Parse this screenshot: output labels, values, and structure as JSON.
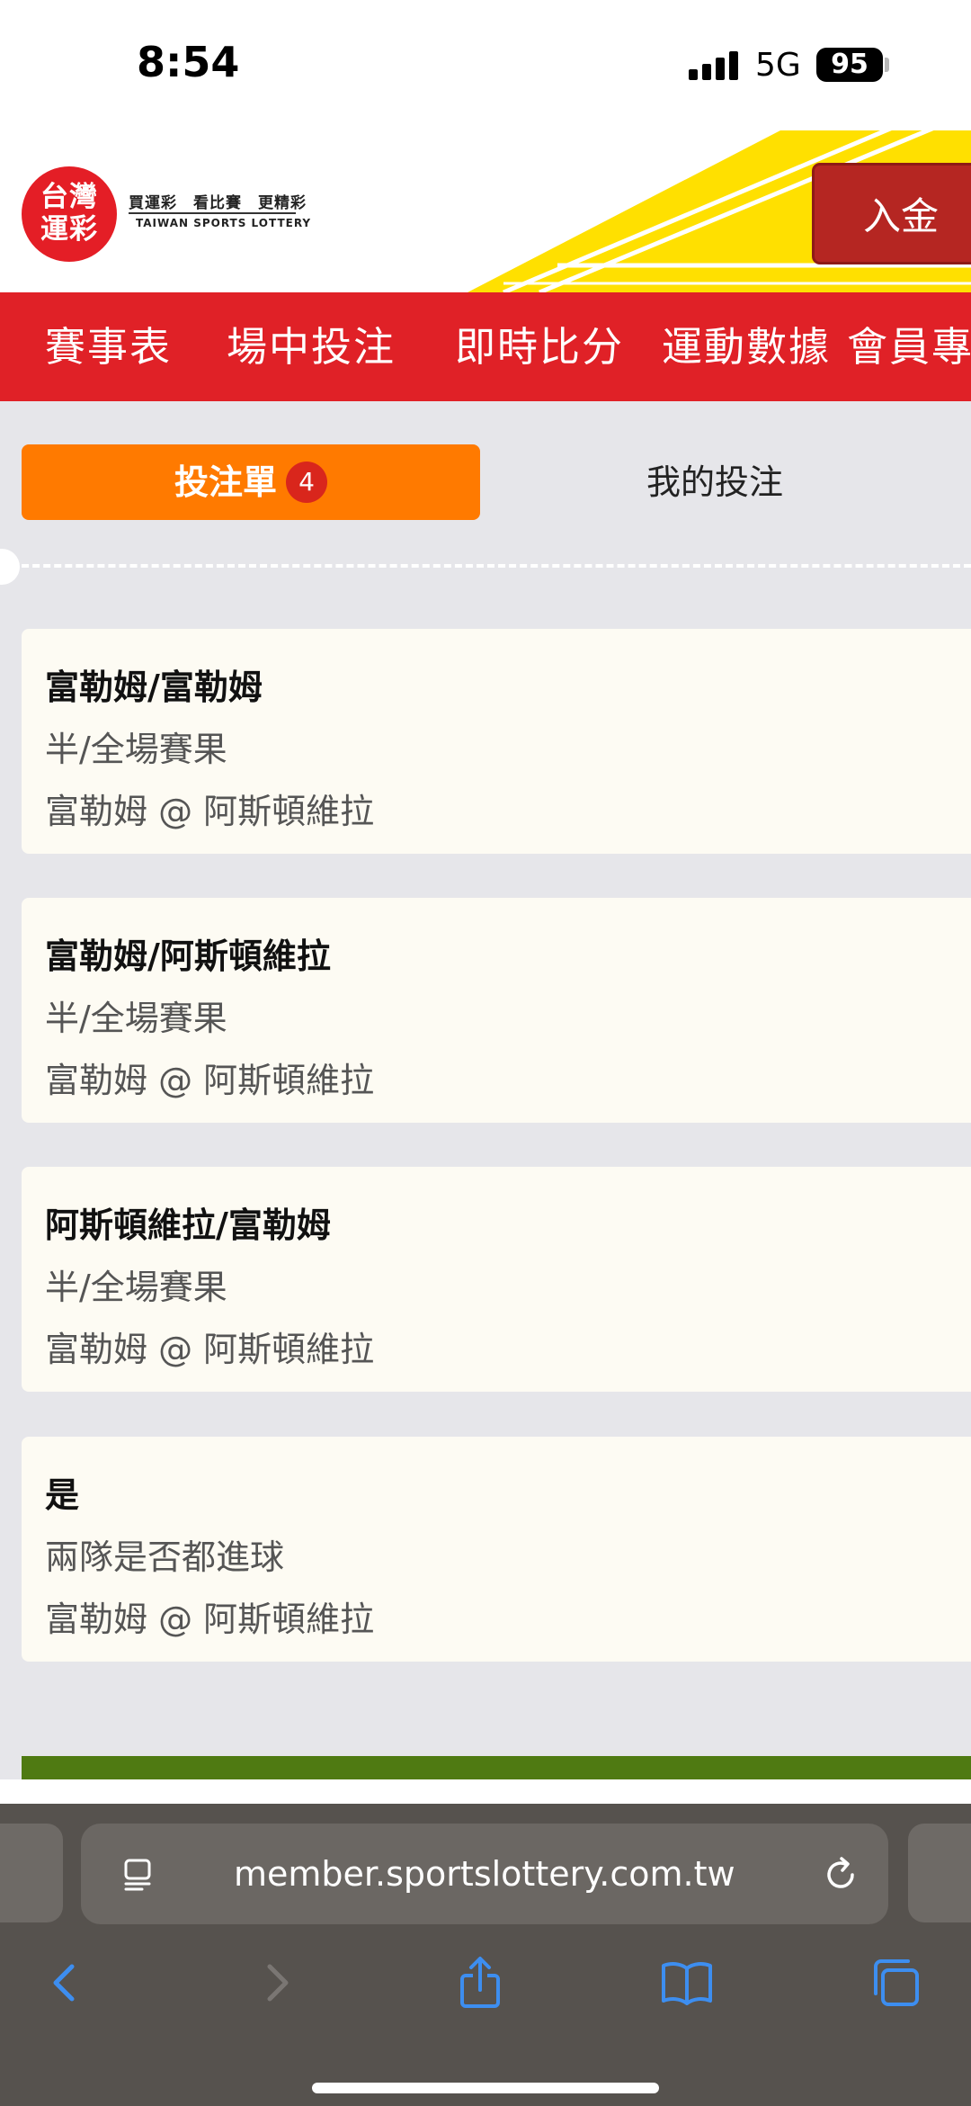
{
  "status_bar": {
    "time": "8:54",
    "network": "5G",
    "battery": "95"
  },
  "header": {
    "logo_text_line1": "台灣",
    "logo_text_line2": "運彩",
    "slogan": "買運彩　看比賽　更精彩",
    "english_name": "TAIWAN SPORTS LOTTERY",
    "deposit_button": "入金"
  },
  "nav": {
    "items": [
      "賽事表",
      "場中投注",
      "即時比分",
      "運動數據",
      "會員專"
    ]
  },
  "tabs": {
    "bet_slip": "投注單",
    "bet_count": "4",
    "my_bets": "我的投注"
  },
  "bets": [
    {
      "selection": "富勒姆/富勒姆",
      "market": "半/全場賽果",
      "match": "富勒姆 @ 阿斯頓維拉"
    },
    {
      "selection": "富勒姆/阿斯頓維拉",
      "market": "半/全場賽果",
      "match": "富勒姆 @ 阿斯頓維拉"
    },
    {
      "selection": "阿斯頓維拉/富勒姆",
      "market": "半/全場賽果",
      "match": "富勒姆 @ 阿斯頓維拉"
    },
    {
      "selection": "是",
      "market": "兩隊是否都進球",
      "match": "富勒姆 @ 阿斯頓維拉"
    }
  ],
  "browser": {
    "url": "member.sportslottery.com.tw"
  },
  "colors": {
    "brand_red": "#e02127",
    "tab_orange": "#ff7a00",
    "deposit_red": "#b52622",
    "banner_yellow": "#ffe000"
  }
}
